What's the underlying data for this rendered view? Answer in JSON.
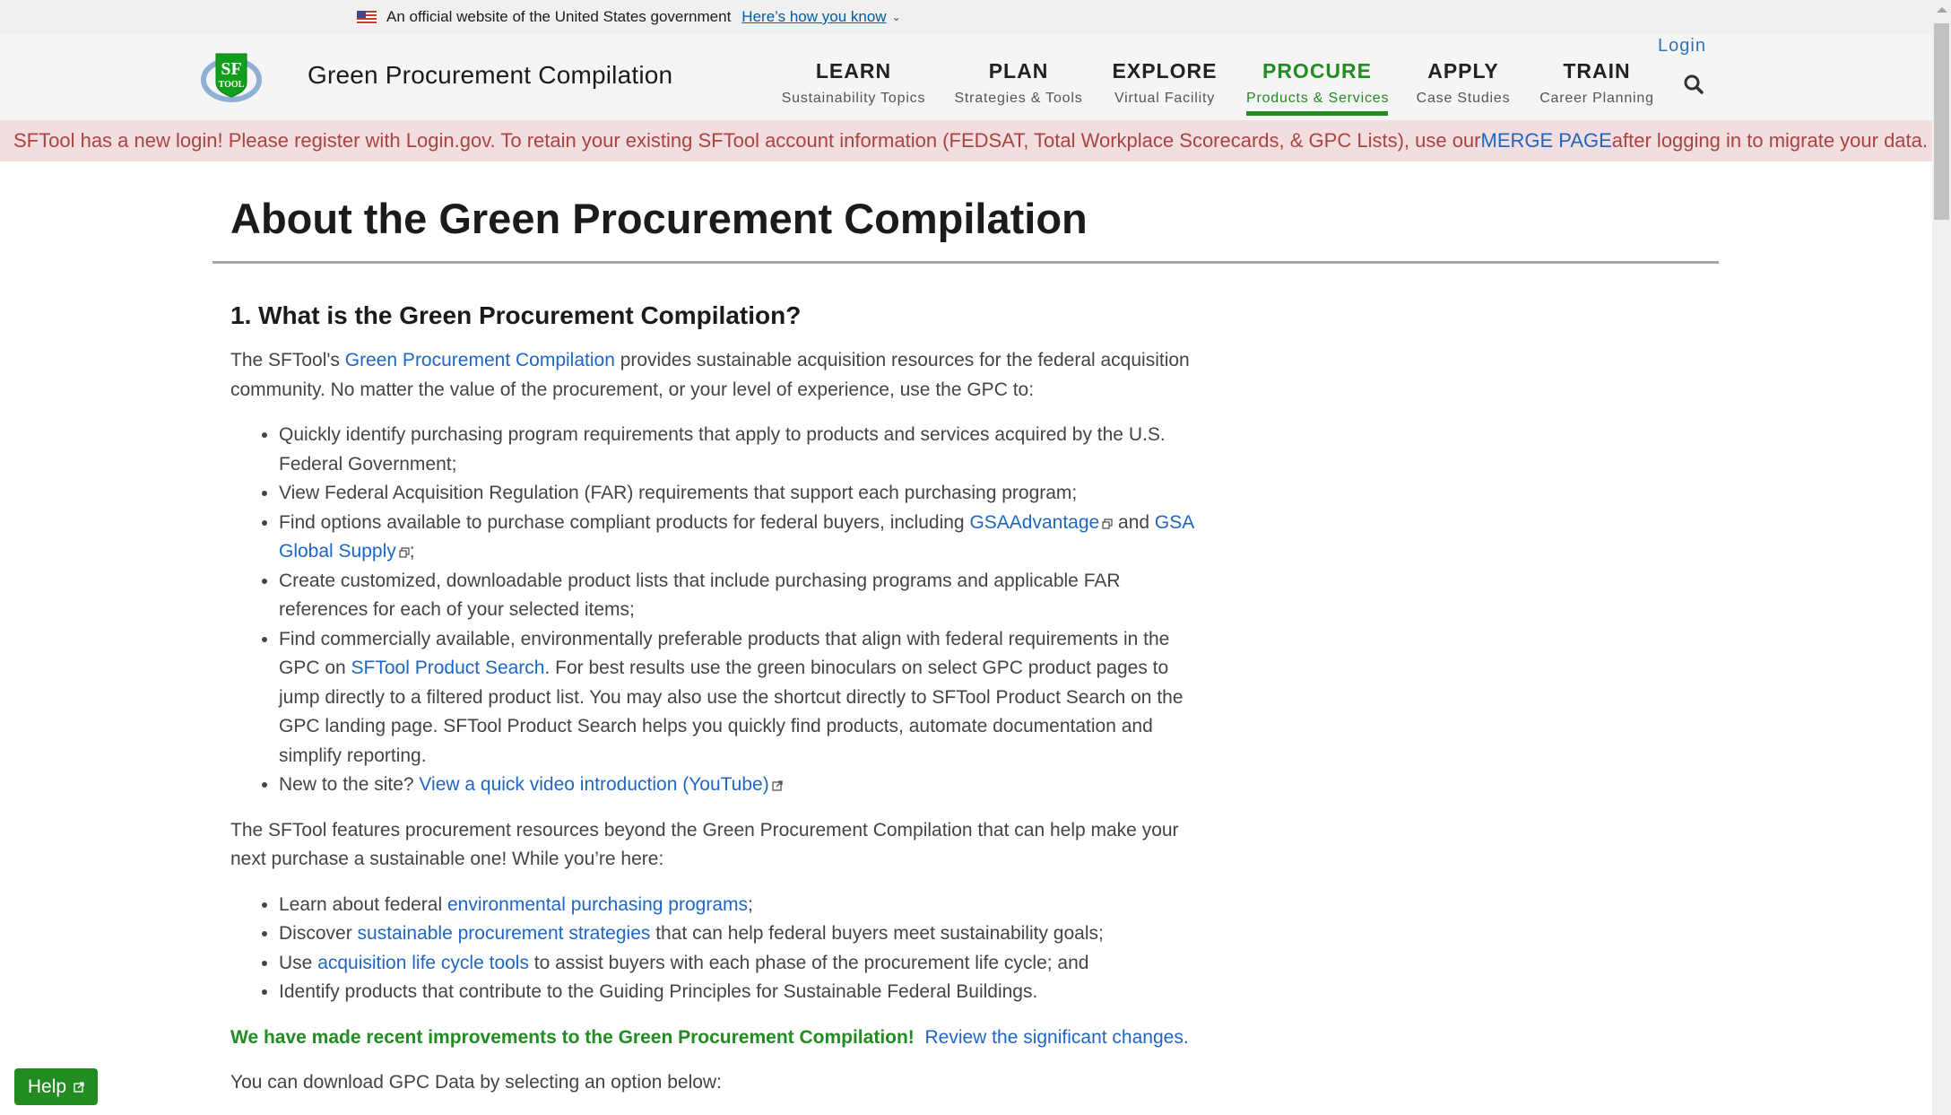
{
  "gov_banner": {
    "text": "An official website of the United States government",
    "link": "Here’s how you know"
  },
  "header": {
    "logo_text_top": "SF",
    "logo_text_bottom": "TOOL",
    "site_title": "Green Procurement Compilation",
    "login": "Login",
    "nav": [
      {
        "main": "LEARN",
        "sub": "Sustainability Topics",
        "active": false
      },
      {
        "main": "PLAN",
        "sub": "Strategies & Tools",
        "active": false
      },
      {
        "main": "EXPLORE",
        "sub": "Virtual Facility",
        "active": false
      },
      {
        "main": "PROCURE",
        "sub": "Products & Services",
        "active": true
      },
      {
        "main": "APPLY",
        "sub": "Case Studies",
        "active": false
      },
      {
        "main": "TRAIN",
        "sub": "Career Planning",
        "active": false
      }
    ]
  },
  "alert": {
    "text_before": "SFTool has a new login! Please register with Login.gov. To retain your existing SFTool account information (FEDSAT, Total Workplace Scorecards, & GPC Lists), use our ",
    "link": "MERGE PAGE",
    "text_after": " after logging in to migrate your data."
  },
  "main": {
    "title": "About the Green Procurement Compilation",
    "section1_heading": "1. What is the Green Procurement Compilation?",
    "intro": {
      "before": "The SFTool's ",
      "link": "Green Procurement Compilation",
      "after": " provides sustainable acquisition resources for the federal acquisition community. No matter the value of the procurement, or your level of experience, use the GPC to:"
    },
    "list1": {
      "item1": "Quickly identify purchasing program requirements that apply to products and services acquired by the U.S. Federal Government;",
      "item2": "View Federal Acquisition Regulation (FAR) requirements that support each purchasing program;",
      "item3_before": "Find options available to purchase compliant products for federal buyers, including ",
      "item3_link1": "GSAAdvantage",
      "item3_mid": " and ",
      "item3_link2": "GSA Global Supply",
      "item3_after": ";",
      "item4": "Create customized, downloadable product lists that include purchasing programs and applicable FAR references for each of your selected items;",
      "item5_before": "Find commercially available, environmentally preferable products that align with federal requirements in the GPC on ",
      "item5_link": "SFTool Product Search",
      "item5_after": ". For best results use the green binoculars on select GPC product pages to jump directly to a filtered product list. You may also use the shortcut directly to SFTool Product Search on the GPC landing page. SFTool Product Search helps you quickly find products, automate documentation and simplify reporting.",
      "item6_before": "New to the site? ",
      "item6_link": "View a quick video introduction (YouTube)"
    },
    "para2": "The SFTool features procurement resources beyond the Green Procurement Compilation that can help make your next purchase a sustainable one! While you’re here:",
    "list2": {
      "item1_before": "Learn about federal ",
      "item1_link": "environmental purchasing programs",
      "item1_after": ";",
      "item2_before": "Discover ",
      "item2_link": "sustainable procurement strategies",
      "item2_after": " that can help federal buyers meet sustainability goals;",
      "item3_before": "Use ",
      "item3_link": "acquisition life cycle tools",
      "item3_after": " to assist buyers with each phase of the procurement life cycle; and",
      "item4": "Identify products that contribute to the Guiding Principles for Sustainable Federal Buildings."
    },
    "improvements": {
      "bold": "We have made recent improvements to the Green Procurement Compilation!",
      "link": "Review the significant changes."
    },
    "download_text": "You can download GPC Data by selecting an option below:"
  },
  "help_button": "Help",
  "colors": {
    "brand_green": "#228b22",
    "link_blue": "#1f66c4",
    "alert_bg": "#f2dede",
    "alert_text": "#a94442"
  }
}
